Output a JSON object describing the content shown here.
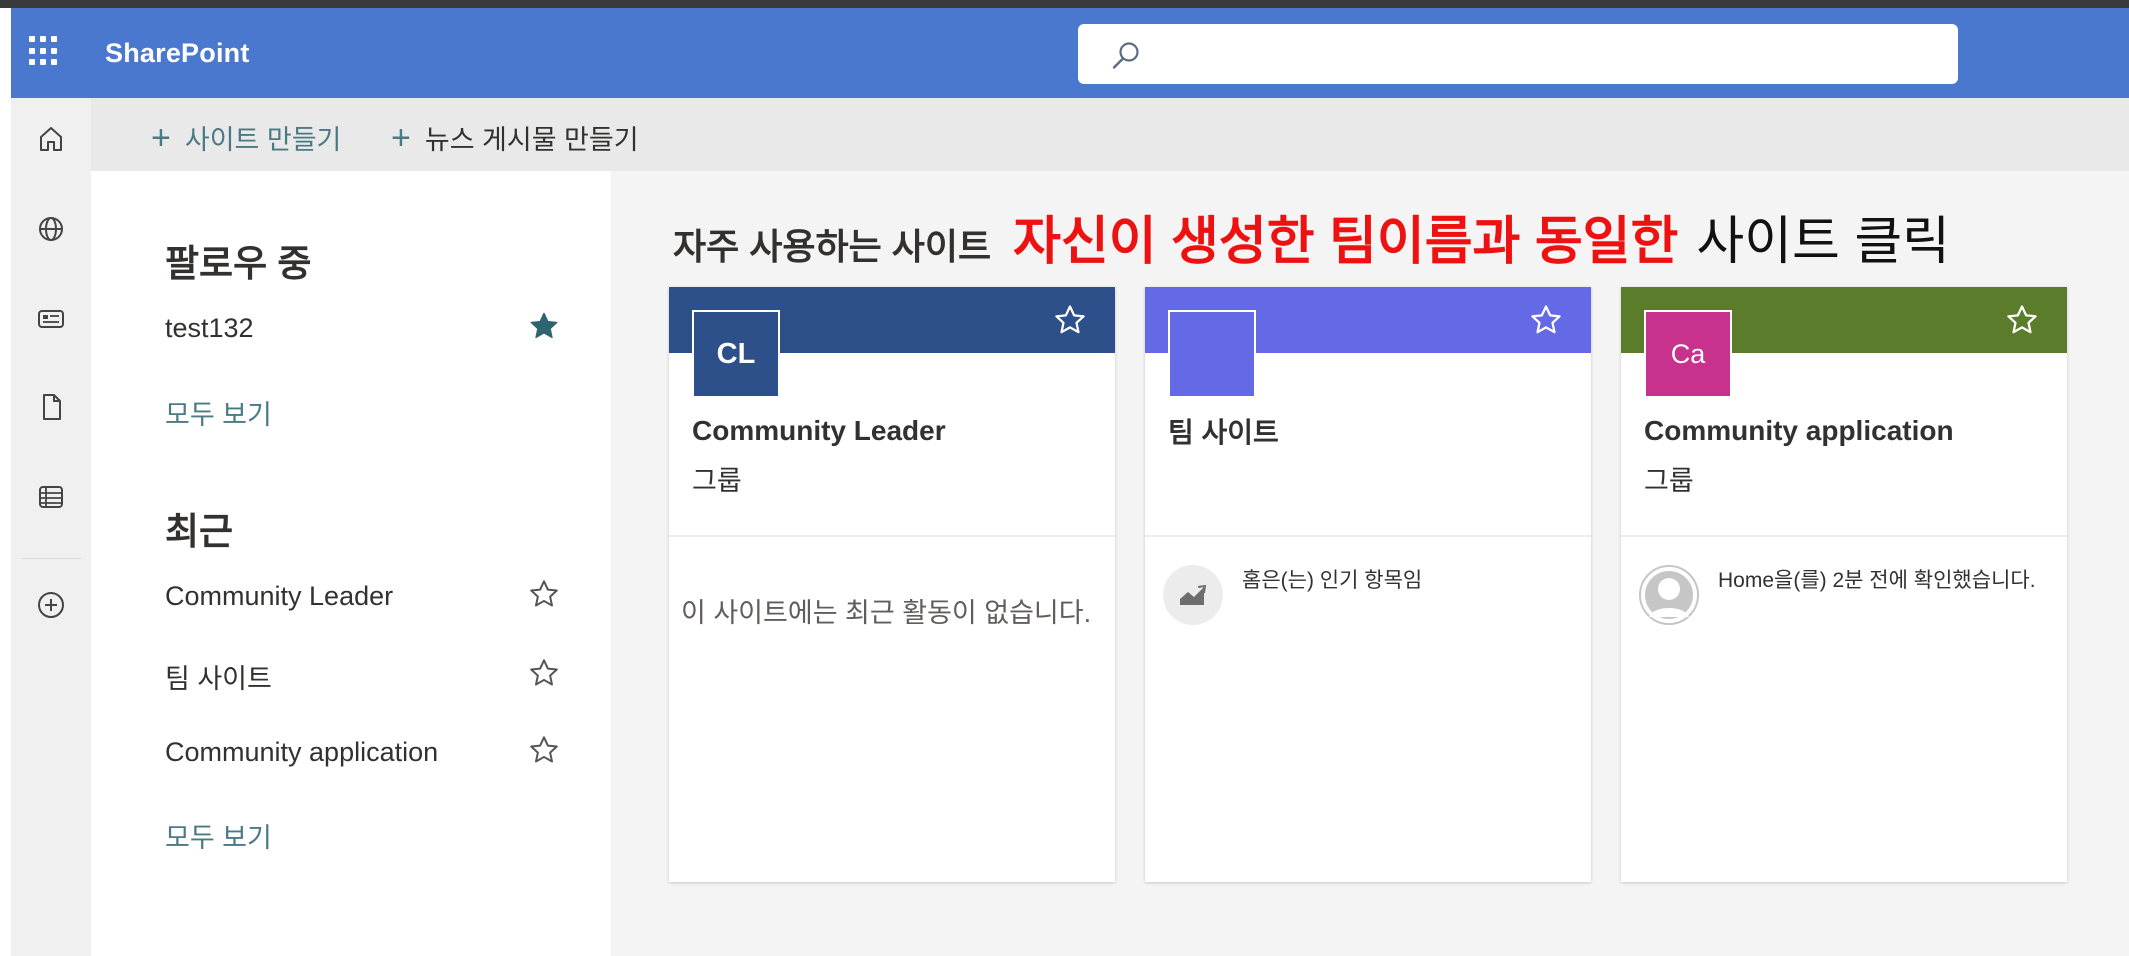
{
  "app": {
    "brand": "SharePoint"
  },
  "search": {
    "placeholder": ""
  },
  "rail": {
    "icons": [
      "home-icon",
      "globe-icon",
      "news-icon",
      "document-icon",
      "list-icon",
      "add-circle-icon"
    ]
  },
  "commands": {
    "create_site": "사이트 만들기",
    "create_news": "뉴스 게시물 만들기",
    "plus_glyph": "+"
  },
  "left": {
    "following_title": "팔로우 중",
    "following_items": [
      {
        "label": "test132",
        "starred": true
      }
    ],
    "following_see_all": "모두 보기",
    "recent_title": "최근",
    "recent_items": [
      {
        "label": "Community Leader",
        "starred": false
      },
      {
        "label": "팀 사이트",
        "starred": false
      },
      {
        "label": "Community application",
        "starred": false
      }
    ],
    "recent_see_all": "모두 보기"
  },
  "main": {
    "heading": "자주 사용하는 사이트",
    "annotation_red": "자신이 생성한 팀이름과 동일한",
    "annotation_black": "사이트 클릭",
    "cards": [
      {
        "initials": "CL",
        "name": "Community Leader",
        "kind": "그룹",
        "band_color": "#2d4f8a",
        "logo_color": "#2d4f8a",
        "activity": "이 사이트에는 최근 활동이 없습니다."
      },
      {
        "initials": "",
        "name": "팀 사이트",
        "kind": "",
        "band_color": "#646ae6",
        "logo_color": "#646ae6",
        "activity": "홈은(는) 인기 항목임",
        "activity_icon": "trending-icon"
      },
      {
        "initials": "Ca",
        "name": "Community application",
        "kind": "그룹",
        "band_color": "#5b7d2b",
        "logo_color": "#c8318c",
        "activity": "Home을(를) 2분 전에 확인했습니다.",
        "activity_icon": "person-avatar-icon"
      }
    ]
  }
}
